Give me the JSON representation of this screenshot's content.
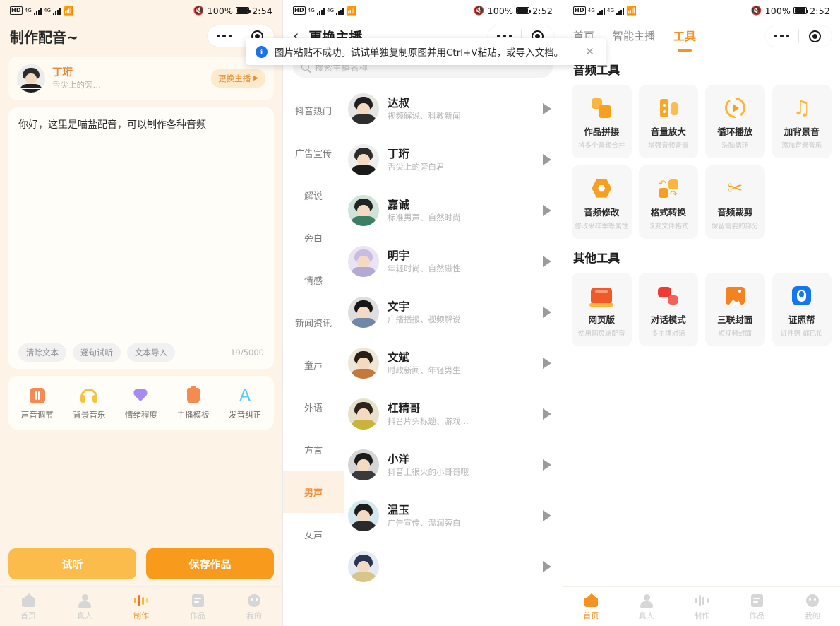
{
  "toast": {
    "icon": "info-icon",
    "message": "图片粘贴不成功。试试单独复制原图并用Ctrl+V粘贴，或导入文档。",
    "close": "✕"
  },
  "left": {
    "status": {
      "battery": "100%",
      "time": "2:54"
    },
    "title": "制作配音~",
    "anchor": {
      "name": "丁珩",
      "desc": "舌尖上的旁…",
      "switch_label": "更换主播",
      "switch_caret": "▶"
    },
    "editor": {
      "text": "你好，这里是喵盐配音，可以制作各种音频",
      "chips": [
        "清除文本",
        "逐句试听",
        "文本导入"
      ],
      "counter": "19/5000"
    },
    "features": [
      {
        "label": "声音调节",
        "icon": "sliders-icon"
      },
      {
        "label": "背景音乐",
        "icon": "headphones-icon"
      },
      {
        "label": "情绪程度",
        "icon": "heart-icon"
      },
      {
        "label": "主播模板",
        "icon": "tag-icon"
      },
      {
        "label": "发音纠正",
        "icon": "letter-a-icon"
      }
    ],
    "actions": {
      "preview": "试听",
      "save": "保存作品"
    },
    "tabs": [
      {
        "label": "首页",
        "icon": "home-icon",
        "active": false
      },
      {
        "label": "真人",
        "icon": "person-icon",
        "active": false
      },
      {
        "label": "制作",
        "icon": "waveform-icon",
        "active": true
      },
      {
        "label": "作品",
        "icon": "document-icon",
        "active": false
      },
      {
        "label": "我的",
        "icon": "face-icon",
        "active": false
      }
    ]
  },
  "middle": {
    "status": {
      "battery": "100%",
      "time": "2:52"
    },
    "back_icon": "‹",
    "title": "更换主播",
    "search_placeholder": "搜索主播名称",
    "categories": [
      "抖音热门",
      "广告宣传",
      "解说",
      "旁白",
      "情感",
      "新闻资讯",
      "童声",
      "外语",
      "方言",
      "男声",
      "女声"
    ],
    "active_category": "男声",
    "anchors": [
      {
        "name": "达叔",
        "desc": "视频解说、科教新闻",
        "avatar_bg": "#e7e5e2",
        "hair": "#1f1f1f",
        "cloth": "#2e2e2e"
      },
      {
        "name": "丁珩",
        "desc": "舌尖上的旁白君",
        "avatar_bg": "#ededed",
        "hair": "#2b2b2b",
        "cloth": "#1a1a1a"
      },
      {
        "name": "嘉诚",
        "desc": "标准男声、自然时尚",
        "avatar_bg": "#cfe3d8",
        "hair": "#232323",
        "cloth": "#3c7f63"
      },
      {
        "name": "明宇",
        "desc": "年轻时尚、自然磁性",
        "avatar_bg": "#e9e3f2",
        "hair": "#c8bde0",
        "cloth": "#b4a9d4"
      },
      {
        "name": "文宇",
        "desc": "广播播报、视频解说",
        "avatar_bg": "#dedede",
        "hair": "#161616",
        "cloth": "#6f87a8"
      },
      {
        "name": "文斌",
        "desc": "时政新闻、年轻男生",
        "avatar_bg": "#efe6da",
        "hair": "#2a1f16",
        "cloth": "#c4793a"
      },
      {
        "name": "杠精哥",
        "desc": "抖音片头标题、游戏…",
        "avatar_bg": "#e7e0cb",
        "hair": "#2e2419",
        "cloth": "#c9b33a"
      },
      {
        "name": "小洋",
        "desc": "抖音上很火的小哥哥哦",
        "avatar_bg": "#d5d5d5",
        "hair": "#1b1b1b",
        "cloth": "#3a3a3a"
      },
      {
        "name": "温玉",
        "desc": "广告宣传、温润旁白",
        "avatar_bg": "#d3e7ef",
        "hair": "#1d1d1d",
        "cloth": "#2a2a2a"
      },
      {
        "name": "",
        "desc": "",
        "avatar_bg": "#e5eaf2",
        "hair": "#2a3550",
        "cloth": "#d8c58a"
      }
    ],
    "play_icon": "play-icon"
  },
  "right": {
    "status": {
      "battery": "100%",
      "time": "2:52"
    },
    "tabs": [
      {
        "label": "首页",
        "active": false
      },
      {
        "label": "智能主播",
        "active": false
      },
      {
        "label": "工具",
        "active": true
      }
    ],
    "sections": [
      {
        "title": "音频工具",
        "tools": [
          {
            "label": "作品拼接",
            "sub": "将多个音频合并",
            "icon": "merge-icon"
          },
          {
            "label": "音量放大",
            "sub": "增强音频音量",
            "icon": "volume-icon"
          },
          {
            "label": "循环播放",
            "sub": "洗脑循环",
            "icon": "loop-icon"
          },
          {
            "label": "加背景音",
            "sub": "添加背景音乐",
            "icon": "music-note-icon"
          },
          {
            "label": "音频修改",
            "sub": "修改采样率等属性",
            "icon": "hex-gear-icon"
          },
          {
            "label": "格式转换",
            "sub": "改变文件格式",
            "icon": "convert-icon"
          },
          {
            "label": "音频裁剪",
            "sub": "保留需要的部分",
            "icon": "scissors-icon"
          }
        ]
      },
      {
        "title": "其他工具",
        "tools": [
          {
            "label": "网页版",
            "sub": "使用网页端配音",
            "icon": "webpage-icon"
          },
          {
            "label": "对话模式",
            "sub": "多主播对话",
            "icon": "chat-icon"
          },
          {
            "label": "三联封面",
            "sub": "短视频封面",
            "icon": "image-icon"
          },
          {
            "label": "证照帮",
            "sub": "证件照 都已拍",
            "icon": "id-card-icon"
          }
        ]
      }
    ],
    "tabs_bottom": [
      {
        "label": "首页",
        "icon": "home-icon",
        "active": true
      },
      {
        "label": "真人",
        "icon": "person-icon",
        "active": false
      },
      {
        "label": "制作",
        "icon": "waveform-icon",
        "active": false
      },
      {
        "label": "作品",
        "icon": "document-icon",
        "active": false
      },
      {
        "label": "我的",
        "icon": "face-icon",
        "active": false
      }
    ]
  }
}
